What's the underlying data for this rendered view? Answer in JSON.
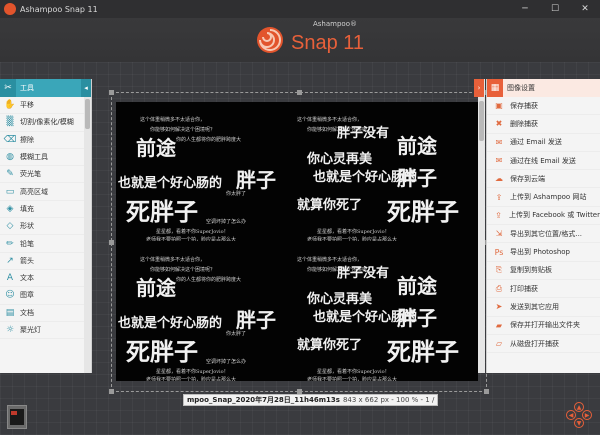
{
  "window": {
    "title": "Ashampoo Snap 11"
  },
  "logo": {
    "brand": "Ashampoo®",
    "product": "Snap 11"
  },
  "tools_panel": {
    "header": "工具",
    "items": [
      {
        "label": "平移",
        "icon": "hand-icon",
        "glyph": "✋"
      },
      {
        "label": "切割/像素化/模糊",
        "icon": "blur-icon",
        "glyph": "▒"
      },
      {
        "label": "擦除",
        "icon": "eraser-icon",
        "glyph": "⌫"
      },
      {
        "label": "模糊工具",
        "icon": "blur-tool-icon",
        "glyph": "◍"
      },
      {
        "label": "荧光笔",
        "icon": "highlighter-icon",
        "glyph": "✎"
      },
      {
        "label": "高亮区域",
        "icon": "highlight-area-icon",
        "glyph": "▭"
      },
      {
        "label": "填充",
        "icon": "fill-icon",
        "glyph": "◈"
      },
      {
        "label": "形状",
        "icon": "shape-icon",
        "glyph": "◇"
      },
      {
        "label": "铅笔",
        "icon": "pencil-icon",
        "glyph": "✏"
      },
      {
        "label": "箭头",
        "icon": "arrow-icon",
        "glyph": "↗"
      },
      {
        "label": "文本",
        "icon": "text-icon",
        "glyph": "A"
      },
      {
        "label": "图章",
        "icon": "stamp-icon",
        "glyph": "☺"
      },
      {
        "label": "文档",
        "icon": "document-icon",
        "glyph": "▤"
      },
      {
        "label": "聚光灯",
        "icon": "spotlight-icon",
        "glyph": "☼"
      }
    ]
  },
  "actions_panel": {
    "header": "图像设置",
    "items": [
      {
        "label": "保存捕获",
        "icon": "save-icon",
        "glyph": "▣"
      },
      {
        "label": "删除捕获",
        "icon": "delete-icon",
        "glyph": "✖"
      },
      {
        "label": "通过 Email 发送",
        "icon": "email-icon",
        "glyph": "✉"
      },
      {
        "label": "通过在线 Email 发送",
        "icon": "online-email-icon",
        "glyph": "✉"
      },
      {
        "label": "保存到云端",
        "icon": "cloud-icon",
        "glyph": "☁"
      },
      {
        "label": "上传到 Ashampoo 网站",
        "icon": "upload-ashampoo-icon",
        "glyph": "⇪"
      },
      {
        "label": "上传到 Facebook 或 Twitter",
        "icon": "upload-social-icon",
        "glyph": "⇪"
      },
      {
        "label": "导出到其它位置/格式...",
        "icon": "export-icon",
        "glyph": "⇲"
      },
      {
        "label": "导出到 Photoshop",
        "icon": "photoshop-icon",
        "glyph": "Ps"
      },
      {
        "label": "复制到剪贴板",
        "icon": "clipboard-icon",
        "glyph": "⎘"
      },
      {
        "label": "打印捕获",
        "icon": "print-icon",
        "glyph": "⎙"
      },
      {
        "label": "发送到其它应用",
        "icon": "send-app-icon",
        "glyph": "➤"
      },
      {
        "label": "保存并打开输出文件夹",
        "icon": "folder-icon",
        "glyph": "▰"
      },
      {
        "label": "从磁盘打开捕获",
        "icon": "open-disk-icon",
        "glyph": "▱"
      }
    ]
  },
  "canvas": {
    "tile_text": {
      "top_small": [
        "这个体重稍微多不太适合你，",
        "你能够如何解决这个困境呢？",
        "你的人生都将你的肥胖跨度大"
      ],
      "line1": "前途",
      "line2": "胖子没有",
      "line3": "你心灵再美",
      "line4": "也就是个好心肠的",
      "line5": "胖子",
      "line6": "就算你死了",
      "line7": "死胖子",
      "line8": "你太胖了",
      "bottom_small": [
        "空调坏掉了怎么办",
        "星星都，看着不你SuperJovio！",
        "老师我不要拍照一个拍，脸应是占那么大"
      ]
    }
  },
  "status": {
    "filename": "mpoo_Snap_2020年7月28日_11h46m13s",
    "meta": "843 x 662 px - 100 % - 1 /"
  }
}
